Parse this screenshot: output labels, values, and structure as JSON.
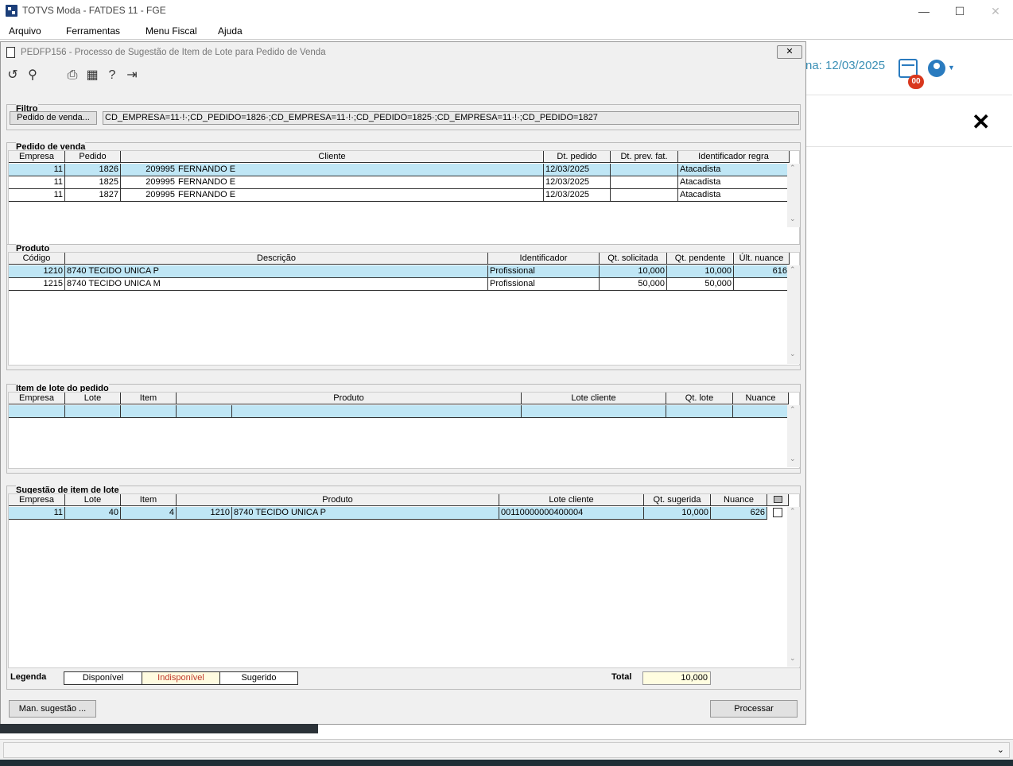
{
  "app": {
    "title": "TOTVS Moda - FATDES 11 - FGE"
  },
  "menu": [
    "Arquivo",
    "Ferramentas",
    "Menu Fiscal",
    "Ajuda"
  ],
  "background": {
    "date_text": "na: 12/03/2025",
    "badge": "00"
  },
  "dialog": {
    "title": "PEDFP156 - Processo de Sugestão de Item de Lote para Pedido de Venda",
    "close_glyph": "✕"
  },
  "filtro": {
    "label": "Filtro",
    "button": "Pedido de venda...",
    "value": "CD_EMPRESA=11·!·;CD_PEDIDO=1826·;CD_EMPRESA=11·!·;CD_PEDIDO=1825·;CD_EMPRESA=11·!·;CD_PEDIDO=1827"
  },
  "pedido": {
    "label": "Pedido de venda",
    "headers": [
      "Empresa",
      "Pedido",
      "Cliente",
      "Dt. pedido",
      "Dt. prev. fat.",
      "Identificador regra"
    ],
    "rows": [
      [
        "11",
        "1826",
        "209995",
        "FERNANDO E",
        "12/03/2025",
        "",
        "Atacadista"
      ],
      [
        "11",
        "1825",
        "209995",
        "FERNANDO E",
        "12/03/2025",
        "",
        "Atacadista"
      ],
      [
        "11",
        "1827",
        "209995",
        "FERNANDO E",
        "12/03/2025",
        "",
        "Atacadista"
      ]
    ]
  },
  "produto": {
    "label": "Produto",
    "headers": [
      "Código",
      "Descrição",
      "Identificador",
      "Qt. solicitada",
      "Qt. pendente",
      "Últ. nuance"
    ],
    "rows": [
      [
        "1210",
        "8740 TECIDO UNICA P",
        "Profissional",
        "10,000",
        "10,000",
        "616"
      ],
      [
        "1215",
        "8740 TECIDO UNICA M",
        "Profissional",
        "50,000",
        "50,000",
        ""
      ]
    ]
  },
  "itemlote": {
    "label": "Item de lote do pedido",
    "headers": [
      "Empresa",
      "Lote",
      "Item",
      "Produto",
      "Lote cliente",
      "Qt. lote",
      "Nuance"
    ]
  },
  "sugestao": {
    "label": "Sugestão de item de lote",
    "headers": [
      "Empresa",
      "Lote",
      "Item",
      "Produto",
      "Lote cliente",
      "Qt. sugerida",
      "Nuance"
    ],
    "rows": [
      [
        "11",
        "40",
        "4",
        "1210",
        "8740 TECIDO UNICA P",
        "00110000000400004",
        "10,000",
        "626"
      ]
    ]
  },
  "legenda": {
    "label": "Legenda",
    "items": [
      "Disponível",
      "Indisponível",
      "Sugerido"
    ],
    "indisponivel_color": "#c0392b",
    "indisponivel_bg": "#fffbe0"
  },
  "total": {
    "label": "Total",
    "value": "10,000"
  },
  "buttons": {
    "man_sugestao": "Man. sugestão ...",
    "processar": "Processar"
  },
  "colors": {
    "selection": "#bfe6f5",
    "accent": "#2a7bbf",
    "badge": "#d9381e"
  }
}
